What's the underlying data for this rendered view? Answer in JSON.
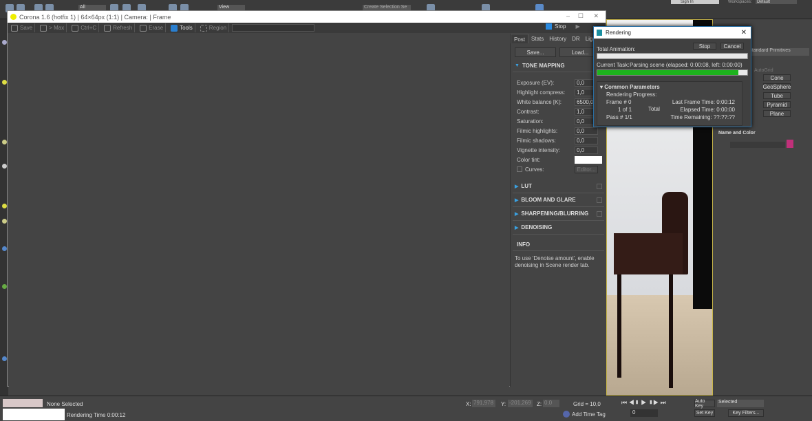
{
  "max_toolbar": {
    "selection_filter": "All",
    "view_dropdown": "View",
    "selection_set": "Create Selection Se",
    "sign_in": "Sign In",
    "workspace_label": "Workspaces:",
    "workspace_value": "Default"
  },
  "corona": {
    "title": "Corona 1.6 (hotfix 1) | 64×64px (1:1) | Camera:  | Frame",
    "toolbar": {
      "save": "Save",
      "to_max": "> Max",
      "copy": "Ctrl+C",
      "refresh": "Refresh",
      "erase": "Erase",
      "tools": "Tools",
      "region": "Region",
      "stop": "Stop"
    },
    "tabs": [
      "Post",
      "Stats",
      "History",
      "DR",
      "Lightmix"
    ],
    "save_btn": "Save...",
    "load_btn": "Load...",
    "tone_mapping": {
      "title": "TONE MAPPING",
      "params": [
        {
          "label": "Exposure (EV):",
          "value": "0,0"
        },
        {
          "label": "Highlight compress:",
          "value": "1,0"
        },
        {
          "label": "White balance [K]:",
          "value": "6500,0"
        },
        {
          "label": "Contrast:",
          "value": "1,0"
        },
        {
          "label": "Saturation:",
          "value": "0,0"
        },
        {
          "label": "Filmic highlights:",
          "value": "0,0"
        },
        {
          "label": "Filmic shadows:",
          "value": "0,0"
        },
        {
          "label": "Vignette intensity:",
          "value": "0,0"
        }
      ],
      "color_tint": "Color tint:",
      "color_tint_value": "#ffffff",
      "curves": "Curves:",
      "editor": "Editor..."
    },
    "sections": [
      "LUT",
      "BLOOM AND GLARE",
      "SHARPENING/BLURRING",
      "DENOISING"
    ],
    "info_title": "INFO",
    "info_text": "To use 'Denoise amount', enable denoising in Scene render tab."
  },
  "rendering": {
    "title": "Rendering",
    "stop": "Stop",
    "cancel": "Cancel",
    "total_animation": "Total Animation:",
    "total_progress": 0,
    "current_task_label": "Current Task:",
    "current_task": "Parsing scene (elapsed: 0:00:08, left: 0:00:00)",
    "task_progress": 0.94,
    "common_params": "Common Parameters",
    "rendering_progress": "Rendering Progress:",
    "frame_label": "Frame #",
    "frame": "0",
    "of": "1 of 1",
    "total": "Total",
    "pass_label": "Pass #",
    "pass": "1/1",
    "last_frame_label": "Last Frame Time:",
    "last_frame": "0:00:12",
    "elapsed_label": "Elapsed Time:",
    "elapsed": "0:00:00",
    "remaining_label": "Time Remaining:",
    "remaining": "??:??:??",
    "accent": "#1db31d"
  },
  "command_panel": {
    "category": "Standard Primitives",
    "autogrid": "AutoGrid",
    "objects": [
      "Cone",
      "GeoSphere",
      "Tube",
      "Pyramid",
      "Plane"
    ],
    "name_color": "Name and Color",
    "color": "#c0307a"
  },
  "status": {
    "selection": "None Selected",
    "render_time": "Rendering Time  0:00:12",
    "x_label": "X:",
    "x": "791,978",
    "y_label": "Y:",
    "y": "-201,269",
    "z_label": "Z:",
    "z": "0,0",
    "grid": "Grid = 10,0",
    "add_time_tag": "Add Time Tag",
    "frame": "0",
    "auto_key": "Auto Key",
    "set_key": "Set Key",
    "key_mode": "Selected",
    "key_filters": "Key Filters..."
  }
}
